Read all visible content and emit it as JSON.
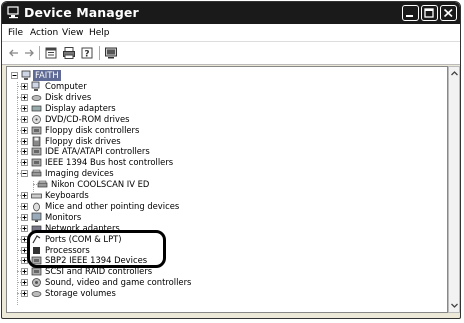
{
  "window": {
    "title": "Device Manager"
  },
  "menu": [
    "File",
    "Action",
    "View",
    "Help"
  ],
  "toolbar": [
    "back-icon",
    "forward-icon",
    "properties-icon",
    "print-icon",
    "help-icon",
    "scan-hardware-icon"
  ],
  "tree": {
    "root": "FAITH",
    "items": [
      {
        "label": "Computer",
        "icon": "computer-icon",
        "state": "collapsed"
      },
      {
        "label": "Disk drives",
        "icon": "disk-drive-icon",
        "state": "collapsed"
      },
      {
        "label": "Display adapters",
        "icon": "display-adapter-icon",
        "state": "collapsed"
      },
      {
        "label": "DVD/CD-ROM drives",
        "icon": "cdrom-icon",
        "state": "collapsed"
      },
      {
        "label": "Floppy disk controllers",
        "icon": "controller-icon",
        "state": "collapsed"
      },
      {
        "label": "Floppy disk drives",
        "icon": "floppy-icon",
        "state": "collapsed"
      },
      {
        "label": "IDE ATA/ATAPI controllers",
        "icon": "controller-icon",
        "state": "collapsed"
      },
      {
        "label": "IEEE 1394 Bus host controllers",
        "icon": "controller-icon",
        "state": "collapsed"
      },
      {
        "label": "Imaging devices",
        "icon": "scanner-icon",
        "state": "expanded"
      },
      {
        "label": "Nikon COOLSCAN IV ED",
        "icon": "scanner-icon",
        "state": "child"
      },
      {
        "label": "Keyboards",
        "icon": "keyboard-icon",
        "state": "collapsed"
      },
      {
        "label": "Mice and other pointing devices",
        "icon": "mouse-icon",
        "state": "collapsed"
      },
      {
        "label": "Monitors",
        "icon": "monitor-icon",
        "state": "collapsed"
      },
      {
        "label": "Network adapters",
        "icon": "network-icon",
        "state": "collapsed"
      },
      {
        "label": "Ports (COM & LPT)",
        "icon": "port-icon",
        "state": "collapsed"
      },
      {
        "label": "Processors",
        "icon": "processor-icon",
        "state": "collapsed"
      },
      {
        "label": "SBP2 IEEE 1394 Devices",
        "icon": "controller-icon",
        "state": "collapsed"
      },
      {
        "label": "SCSI and RAID controllers",
        "icon": "controller-icon",
        "state": "collapsed"
      },
      {
        "label": "Sound, video and game controllers",
        "icon": "sound-icon",
        "state": "collapsed"
      },
      {
        "label": "Storage volumes",
        "icon": "disk-drive-icon",
        "state": "collapsed"
      }
    ]
  },
  "colors": {
    "titlebar": "#1a1a1a",
    "selection": "#5f6b95",
    "callout": "#000000"
  }
}
